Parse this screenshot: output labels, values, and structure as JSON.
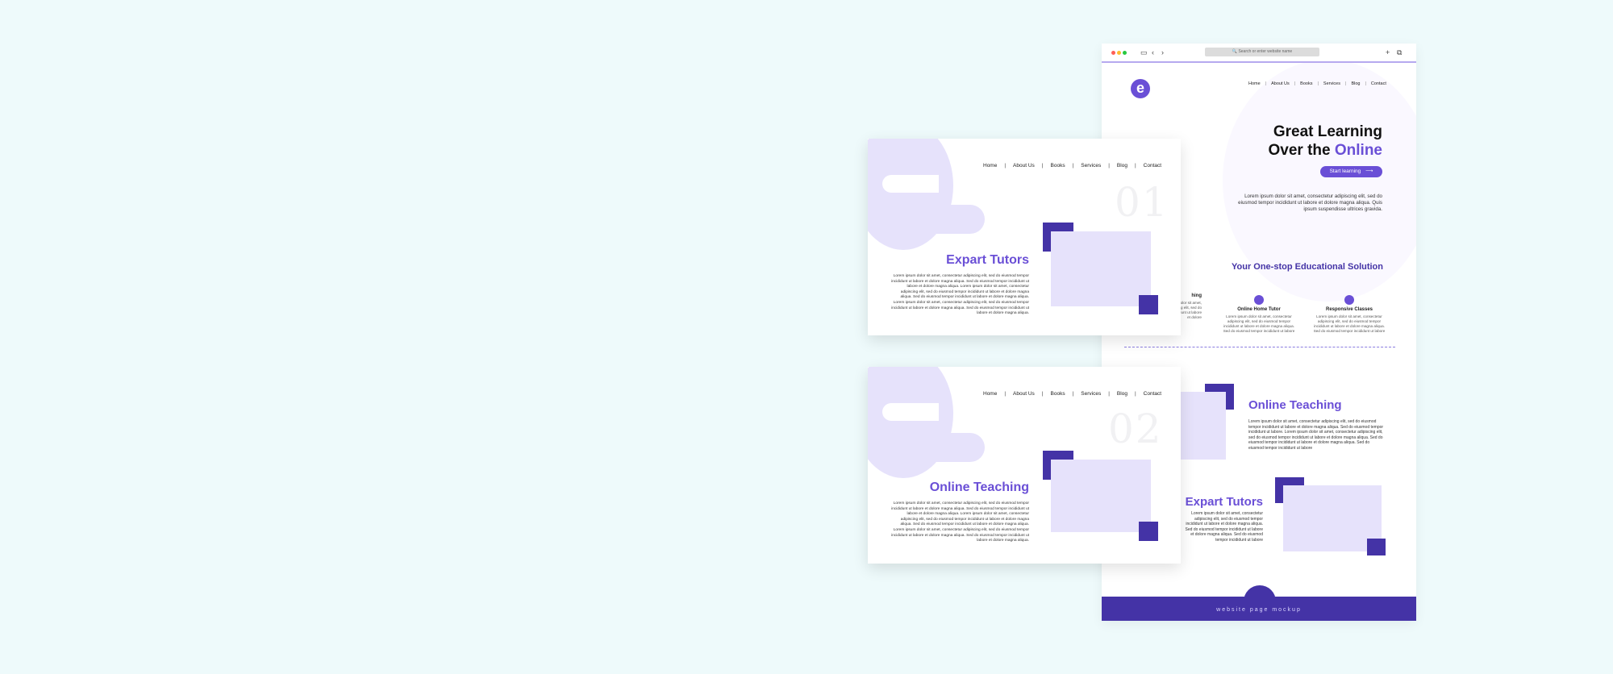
{
  "browser": {
    "address_placeholder": "🔍 Search or enter website name",
    "nav": [
      "Home",
      "About Us",
      "Books",
      "Services",
      "Blog",
      "Contact"
    ],
    "logo_letter": "e",
    "hero": {
      "line1": "Great Learning",
      "line2_prefix": "Over the ",
      "line2_accent": "Online",
      "button": "Start learning",
      "button_arrow": "⟶",
      "paragraph": "Lorem ipsum dolor sit amet, consectetur adipiscing elit, sed do eiusmod tempor incididunt ut labore et dolore magna aliqua. Quis ipsum suspendisse ultrices gravida."
    },
    "solution_title": "Your One-stop Educational Solution",
    "features": [
      {
        "title": "hing",
        "text": "Lorem ipsum dolor sit amet, consectetur adipiscing elit, sed do eiusmod tempor incididunt ut labore et dolore"
      },
      {
        "title": "Online Home Tutor",
        "text": "Lorem ipsum dolor sit amet, consectetur adipiscing elit, sed do eiusmod tempor incididunt ut labore et dolore magna aliqua. Sed do eiusmod tempor incididunt ut labore"
      },
      {
        "title": "Responsive Classes",
        "text": "Lorem ipsum dolor sit amet, consectetur adipiscing elit, sed do eiusmod tempor incididunt ut labore et dolore magna aliqua. Sed do eiusmod tempor incididunt ut labore"
      }
    ],
    "online_teaching": {
      "title": "Online Teaching",
      "text": "Lorem ipsum dolor sit amet, consectetur adipiscing elit, sed do eiusmod tempor incididunt ut labore et dolore magna aliqua. Sed do eiusmod tempor incididunt ut labore. Lorem ipsum dolor sit amet, consectetur adipiscing elit, sed do eiusmod tempor incididunt ut labore et dolore magna aliqua. Sed do eiusmod tempor incididunt ut labore et dolore magna aliqua. Sed do eiusmod tempor incididunt ut labore"
    },
    "expart_tutors": {
      "title": "Expart Tutors",
      "text": "Lorem ipsum dolor sit amet, consectetur adipiscing elit, sed do eiusmod tempor incididunt ut labore et dolore magna aliqua. Sed do eiusmod tempor incididunt ut labore et dolore magna aliqua. Sed do eiusmod tempor incididunt ut labore"
    },
    "footer_label": "website page mockup"
  },
  "panel1": {
    "nav": [
      "Home",
      "About Us",
      "Books",
      "Services",
      "Blog",
      "Contact"
    ],
    "number": "01",
    "title": "Expart Tutors",
    "text": "Lorem ipsum dolor sit amet, consectetur adipiscing elit, sed do eiusmod tempor incididunt ut labore et dolore magna aliqua. Sed do eiusmod tempor incididunt ut labore et dolore magna aliqua. Lorem ipsum dolor sit amet, consectetur adipiscing elit, sed do eiusmod tempor incididunt ut labore et dolore magna aliqua. Sed do eiusmod tempor incididunt ut labore et dolore magna aliqua. Lorem ipsum dolor sit amet, consectetur adipiscing elit, sed do eiusmod tempor incididunt ut labore et dolore magna aliqua. Sed do eiusmod tempor incididunt ut labore et dolore magna aliqua."
  },
  "panel2": {
    "nav": [
      "Home",
      "About Us",
      "Books",
      "Services",
      "Blog",
      "Contact"
    ],
    "number": "02",
    "title": "Online Teaching",
    "text": "Lorem ipsum dolor sit amet, consectetur adipiscing elit, sed do eiusmod tempor incididunt ut labore et dolore magna aliqua. Sed do eiusmod tempor incididunt ut labore et dolore magna aliqua. Lorem ipsum dolor sit amet, consectetur adipiscing elit, sed do eiusmod tempor incididunt ut labore et dolore magna aliqua. Sed do eiusmod tempor incididunt ut labore et dolore magna aliqua. Lorem ipsum dolor sit amet, consectetur adipiscing elit, sed do eiusmod tempor incididunt ut labore et dolore magna aliqua. Sed do eiusmod tempor incididunt ut labore et dolore magna aliqua."
  },
  "colors": {
    "background": "#eefafb",
    "accent": "#6a4fd6",
    "deep_purple": "#4433a6",
    "lilac": "#e6e2fb"
  }
}
